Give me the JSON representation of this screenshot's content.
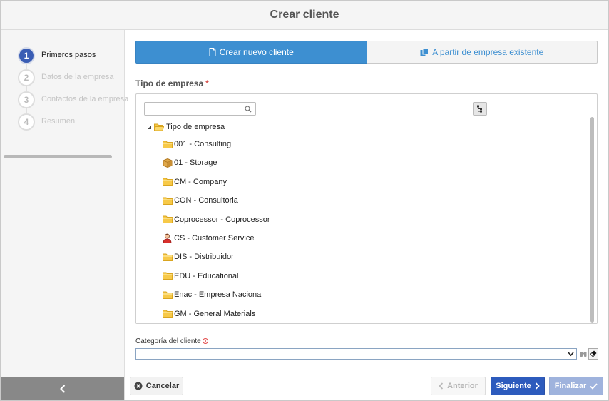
{
  "window": {
    "title": "Crear cliente"
  },
  "wizard": {
    "steps": [
      {
        "number": "1",
        "label": "Primeros pasos",
        "active": true
      },
      {
        "number": "2",
        "label": "Datos de la empresa",
        "active": false
      },
      {
        "number": "3",
        "label": "Contactos de la empresa",
        "active": false
      },
      {
        "number": "4",
        "label": "Resumen",
        "active": false
      }
    ]
  },
  "mode_tabs": {
    "new": "Crear nuevo cliente",
    "existing": "A partir de empresa existente"
  },
  "company_type": {
    "label": "Tipo de empresa",
    "required_mark": "*",
    "search_value": "",
    "root_label": "Tipo de empresa",
    "items": [
      {
        "label": "001 - Consulting",
        "icon": "folder-icon"
      },
      {
        "label": "01 - Storage",
        "icon": "box-icon"
      },
      {
        "label": "CM - Company",
        "icon": "folder-icon"
      },
      {
        "label": "CON - Consultoria",
        "icon": "folder-icon"
      },
      {
        "label": "Coprocessor - Coprocessor",
        "icon": "folder-icon"
      },
      {
        "label": "CS - Customer Service",
        "icon": "person-icon"
      },
      {
        "label": "DIS - Distribuidor",
        "icon": "folder-icon"
      },
      {
        "label": "EDU - Educational",
        "icon": "folder-icon"
      },
      {
        "label": "Enac - Empresa Nacional",
        "icon": "folder-icon"
      },
      {
        "label": "GM - General Materials",
        "icon": "folder-icon"
      }
    ]
  },
  "client_category": {
    "label": "Categoría del cliente",
    "value": ""
  },
  "footer": {
    "cancel": "Cancelar",
    "previous": "Anterior",
    "next": "Siguiente",
    "finish": "Finalizar"
  },
  "colors": {
    "primary_blue": "#3d8fd1",
    "next_button": "#2d5bbd",
    "finish_button": "#9fb3dd",
    "active_step": "#3a5db4",
    "folder": "#f7c948",
    "required": "#d9534f"
  }
}
